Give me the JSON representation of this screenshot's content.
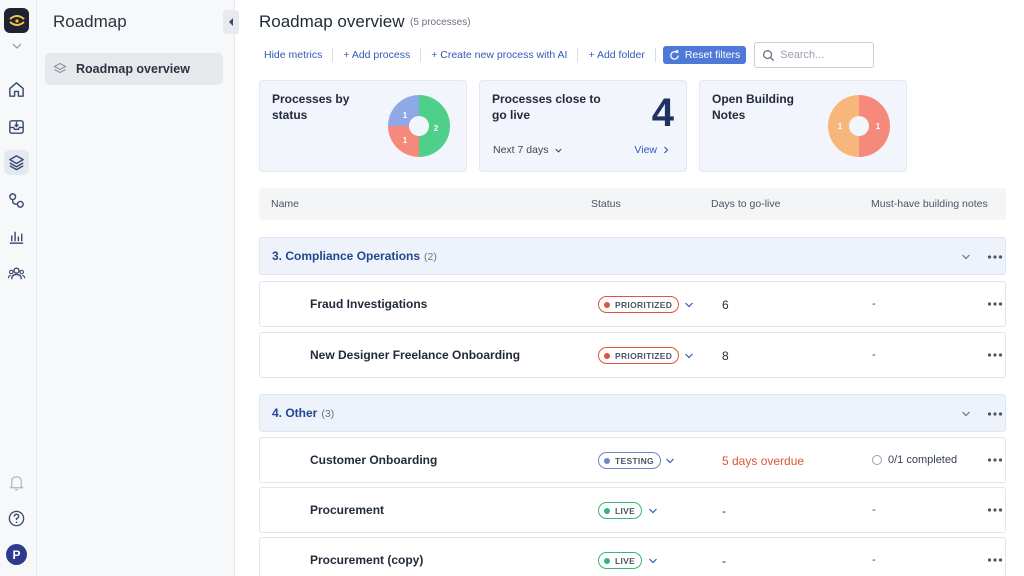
{
  "sidebar": {
    "title": "Roadmap",
    "items": [
      {
        "label": "Roadmap overview"
      }
    ]
  },
  "rail": {
    "user_initial": "P",
    "icons": [
      "home-icon",
      "inbox-icon",
      "layers-icon",
      "workflow-icon",
      "bar-chart-icon",
      "users-icon",
      "bell-icon",
      "help-icon"
    ]
  },
  "page": {
    "title": "Roadmap overview",
    "count": "(5 processes)"
  },
  "toolbar": {
    "hide_metrics": "Hide metrics",
    "add_process": "+ Add process",
    "create_ai": "+ Create new process with AI",
    "add_folder": "+ Add folder",
    "reset_filters": "Reset filters",
    "search_placeholder": "Search..."
  },
  "cards": {
    "status": {
      "title": "Processes by status",
      "slices": [
        {
          "value": 1,
          "color": "#8fa9e6"
        },
        {
          "value": 2,
          "color": "#4fd08a"
        },
        {
          "value": 1,
          "color": "#f58a7c"
        }
      ]
    },
    "close": {
      "title": "Processes close to go live",
      "number": "4",
      "period": "Next 7 days",
      "view": "View"
    },
    "notes": {
      "title": "Open Building Notes",
      "slices": [
        {
          "value": 1,
          "color": "#f7b77a"
        },
        {
          "value": 1,
          "color": "#f58a7c"
        }
      ]
    }
  },
  "table": {
    "headers": {
      "name": "Name",
      "status": "Status",
      "days": "Days to go-live",
      "notes": "Must-have building notes"
    }
  },
  "groups": [
    {
      "name": "3. Compliance Operations",
      "count": "(2)"
    },
    {
      "name": "4. Other",
      "count": "(3)"
    }
  ],
  "rows": [
    {
      "name": "Fraud Investigations",
      "status": "PRIORITIZED",
      "days": "6",
      "notes": "-"
    },
    {
      "name": "New Designer Freelance Onboarding",
      "status": "PRIORITIZED",
      "days": "8",
      "notes": "-"
    },
    {
      "name": "Customer Onboarding",
      "status": "TESTING",
      "days": "5 days overdue",
      "notes": "0/1 completed"
    },
    {
      "name": "Procurement",
      "status": "LIVE",
      "days": "-",
      "notes": "-"
    },
    {
      "name": "Procurement (copy)",
      "status": "LIVE",
      "days": "-",
      "notes": "-"
    }
  ],
  "colors": {
    "prioritized": "#e0533c",
    "testing": "#6c87c4",
    "live": "#2fb877",
    "accent": "#2f5bb7"
  }
}
